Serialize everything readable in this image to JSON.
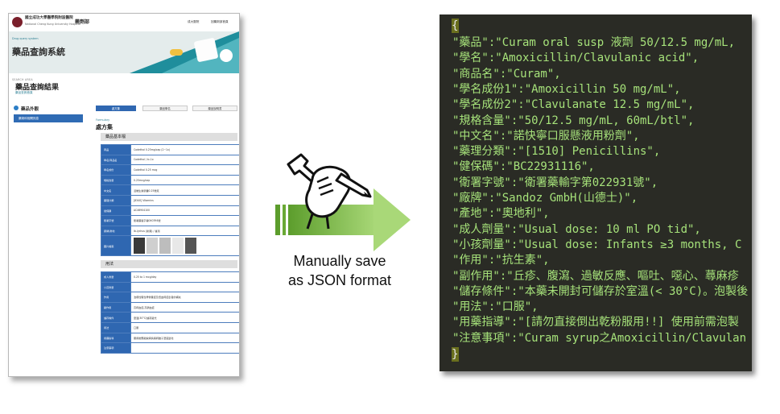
{
  "screenshot": {
    "hospital_name": "國立成功大學醫學院附設醫院",
    "hospital_name_en": "National Cheng Kung University Hospital",
    "department": "藥劑部",
    "nav": [
      "成大醫院",
      "回藥劑部首頁"
    ],
    "hero_small": "Drug query system",
    "hero_title": "藥品查詢系統",
    "section_label": "SEARCH AREA",
    "result_title": "藥品查詢結果",
    "breadcrumb": "藥品查詢首頁",
    "left_heading": "藥品外觀",
    "left_button": "藥劑科相關訊息",
    "tabs": [
      "處方集",
      "藥品學名",
      "藥品說明書"
    ],
    "sub_small": "Formulary",
    "sub_title": "處方集",
    "basic_section": "藥品基本檔",
    "basic_rows": [
      {
        "k": "商品",
        "v": "Codethol 0.25mg/cap (2~1x)"
      },
      {
        "k": "學名/商品名",
        "v": "Codethol / tc-1x"
      },
      {
        "k": "學名成份",
        "v": "Codethol 0.25 mcg"
      },
      {
        "k": "規格含量",
        "v": "0.25mcg/cap"
      },
      {
        "k": "中文名",
        "v": "活維生素膠囊0.25微克"
      },
      {
        "k": "藥理分類",
        "v": "[8340] Vitamins"
      },
      {
        "k": "健保碼",
        "v": "AC46904100"
      },
      {
        "k": "衛署字號",
        "v": "衛署藥製字第040394號"
      },
      {
        "k": "廠牌/產地",
        "v": "Ib-lychus (新興) / 臺灣"
      },
      {
        "k": "圖片檔案",
        "v": ""
      }
    ],
    "usage_section": "用法",
    "usage_rows": [
      {
        "k": "成人劑量",
        "v": "0.25 to 1 mcg/day"
      },
      {
        "k": "小孩劑量",
        "v": ""
      },
      {
        "k": "作用",
        "v": "治療性腎性骨營養症及低血鈣症患者的補充"
      },
      {
        "k": "副作用",
        "v": "高鈣血症,高磷血症"
      },
      {
        "k": "儲存條件",
        "v": "室溫(30°C)儲存避光"
      },
      {
        "k": "用法",
        "v": "口服"
      },
      {
        "k": "用藥指導",
        "v": "服用後應觀察病情與鈣離子濃度變化"
      },
      {
        "k": "注意事項",
        "v": ""
      }
    ]
  },
  "arrow": {
    "label_line1": "Manually save",
    "label_line2": "as JSON format",
    "icon": "fist-wrench-icon"
  },
  "json_panel": {
    "open_brace": "{",
    "close_brace": "}",
    "lines": [
      "\"藥品\":\"Curam oral susp 液劑 50/12.5 mg/mL,",
      "\"學名\":\"Amoxicillin/Clavulanic acid\",",
      "\"商品名\":\"Curam\",",
      "\"學名成份1\":\"Amoxicillin 50 mg/mL\",",
      "\"學名成份2\":\"Clavulanate 12.5 mg/mL\",",
      "\"規格含量\":\"50/12.5 mg/mL, 60mL/btl\",",
      "\"中文名\":\"諾快寧口服懸液用粉劑\",",
      "\"藥理分類\":\"[1510] Penicillins\",",
      "\"健保碼\":\"BC22931116\",",
      "\"衛署字號\":\"衛署藥輸字第022931號\",",
      "\"廠牌\":\"Sandoz GmbH(山德士)\",",
      "\"產地\":\"奧地利\",",
      "\"成人劑量\":\"Usual dose: 10 ml PO tid\",",
      "\"小孩劑量\":\"Usual dose: Infants ≥3 months, C",
      "\"作用\":\"抗生素\",",
      "\"副作用\":\"丘疹、腹瀉、過敏反應、嘔吐、噁心、蕁麻疹",
      "\"儲存條件\":\"本藥未開封可儲存於室溫(< 30°C)。泡製後",
      "\"用法\":\"口服\",",
      "\"用藥指導\":\"[請勿直接倒出乾粉服用!!] 使用前需泡製",
      "\"注意事項\":\"Curam syrup之Amoxicillin/Clavulan"
    ]
  },
  "colors": {
    "json_bg": "#2a2b25",
    "json_text": "#a6e27a",
    "arrow_green": "#7fbf3f",
    "table_key_blue": "#2f67b1"
  }
}
